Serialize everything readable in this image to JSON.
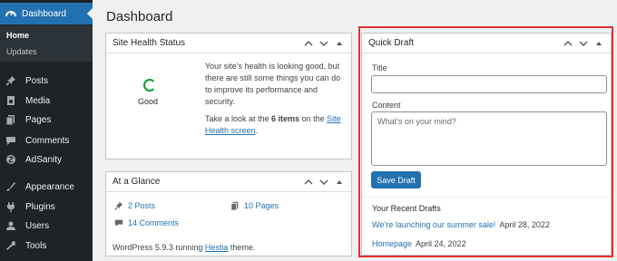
{
  "sidebar": {
    "dashboard_label": "Dashboard",
    "sub_home": "Home",
    "sub_updates": "Updates",
    "items": [
      {
        "label": "Posts",
        "icon": "pin-icon"
      },
      {
        "label": "Media",
        "icon": "media-icon"
      },
      {
        "label": "Pages",
        "icon": "pages-icon"
      },
      {
        "label": "Comments",
        "icon": "comments-icon"
      },
      {
        "label": "AdSanity",
        "icon": "adsanity-icon"
      },
      {
        "label": "Appearance",
        "icon": "brush-icon"
      },
      {
        "label": "Plugins",
        "icon": "plug-icon"
      },
      {
        "label": "Users",
        "icon": "user-icon"
      },
      {
        "label": "Tools",
        "icon": "wrench-icon"
      }
    ]
  },
  "page": {
    "title": "Dashboard"
  },
  "site_health": {
    "title": "Site Health Status",
    "status": "Good",
    "message": "Your site’s health is looking good, but there are still some things you can do to improve its performance and security.",
    "look_prefix": "Take a look at the ",
    "items_count": "6 items",
    "look_mid": " on the ",
    "link_text": "Site Health screen",
    "look_suffix": "."
  },
  "glance": {
    "title": "At a Glance",
    "posts": "2 Posts",
    "pages": "10 Pages",
    "comments": "14 Comments",
    "footer_prefix": "WordPress 5.9.3 running ",
    "theme": "Hestia",
    "footer_suffix": " theme."
  },
  "quick_draft": {
    "title": "Quick Draft",
    "title_label": "Title",
    "title_value": "",
    "content_label": "Content",
    "content_placeholder": "What’s on your mind?",
    "save_label": "Save Draft",
    "recent_title": "Your Recent Drafts",
    "drafts": [
      {
        "title": "We’re launching our summer sale!",
        "date": "April 28, 2022"
      },
      {
        "title": "Homepage",
        "date": "April 24, 2022"
      }
    ]
  },
  "colors": {
    "accent": "#2271b1",
    "sidebar": "#1d2327",
    "highlight": "#e03131"
  }
}
